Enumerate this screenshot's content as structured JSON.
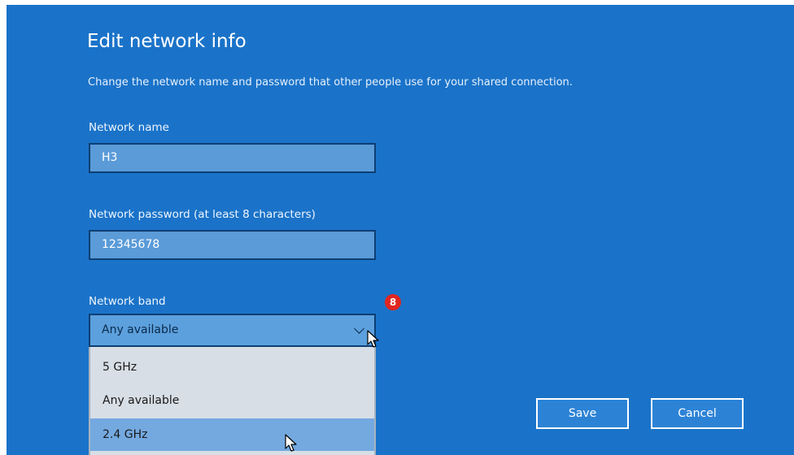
{
  "dialog": {
    "title": "Edit network info",
    "description": "Change the network name and password that other people use for your shared connection."
  },
  "network_name": {
    "label": "Network name",
    "value": "H3"
  },
  "network_password": {
    "label": "Network password (at least 8 characters)",
    "value": "12345678"
  },
  "network_band": {
    "label": "Network band",
    "selected": "Any available",
    "options": [
      "5 GHz",
      "Any available",
      "2.4 GHz"
    ],
    "highlighted_option": "2.4 GHz"
  },
  "step_badge": {
    "number": "8",
    "color": "#e0261f"
  },
  "buttons": {
    "save": "Save",
    "cancel": "Cancel"
  },
  "colors": {
    "background": "#1a73c9",
    "field_fill": "#5a9bd8",
    "dropdown_fill": "#d7dee5",
    "highlight": "#74a9e0"
  }
}
